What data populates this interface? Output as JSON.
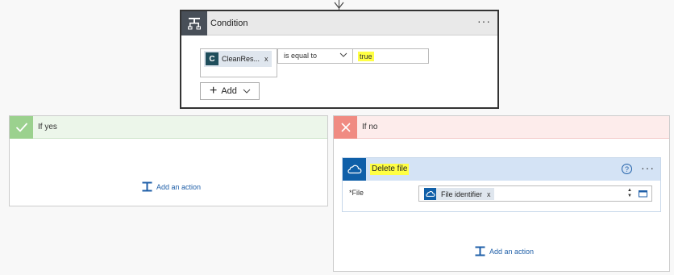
{
  "condition": {
    "title": "Condition",
    "menu_label": "···",
    "token": {
      "letter": "C",
      "label": "CleanRes...",
      "remove": "x"
    },
    "operator": "is equal to",
    "value": "true",
    "add_label": "Add"
  },
  "yes_branch": {
    "title": "If yes",
    "add_action_label": "Add an action"
  },
  "no_branch": {
    "title": "If no",
    "action": {
      "title": "Delete file",
      "help_label": "?",
      "menu_label": "···",
      "field_label": "*File",
      "token_label": "File identifier",
      "token_remove": "x"
    },
    "add_action_label": "Add an action"
  },
  "colors": {
    "yes_accent": "#9bd18e",
    "no_accent": "#f08b82",
    "onedrive_blue": "#0f5fa8",
    "highlight": "#ffff44"
  }
}
